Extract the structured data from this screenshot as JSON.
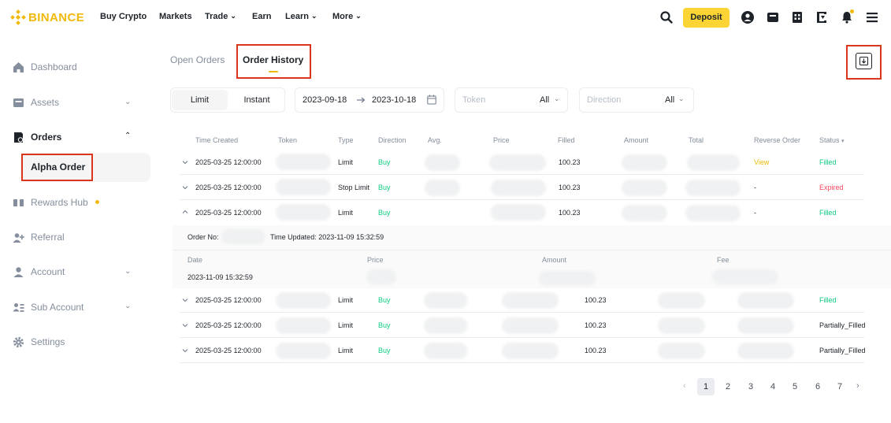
{
  "header": {
    "brand": "BINANCE",
    "nav": [
      {
        "label": "Buy Crypto",
        "has_dropdown": false
      },
      {
        "label": "Markets",
        "has_dropdown": false
      },
      {
        "label": "Trade",
        "has_dropdown": true
      },
      {
        "label": "Earn",
        "has_dropdown": false
      },
      {
        "label": "Learn",
        "has_dropdown": true
      },
      {
        "label": "More",
        "has_dropdown": true
      }
    ],
    "deposit_label": "Deposit",
    "icons": [
      "search-icon",
      "user-icon",
      "wallet-icon",
      "orders-icon",
      "download-app-icon",
      "bell-icon",
      "menu-icon"
    ],
    "accent": "#fcd535"
  },
  "sidebar": {
    "items": [
      {
        "label": "Dashboard",
        "icon": "home-icon"
      },
      {
        "label": "Assets",
        "icon": "wallet-icon",
        "expandable": true
      },
      {
        "label": "Orders",
        "icon": "orders-icon",
        "expanded": true
      },
      {
        "label": "Rewards Hub",
        "icon": "rewards-icon",
        "badge_dot": true
      },
      {
        "label": "Referral",
        "icon": "referral-icon"
      },
      {
        "label": "Account",
        "icon": "account-icon",
        "expandable": true
      },
      {
        "label": "Sub Account",
        "icon": "sub-account-icon",
        "expandable": true
      },
      {
        "label": "Settings",
        "icon": "settings-icon"
      }
    ],
    "sub_item": "Alpha Order"
  },
  "tabs": {
    "open_orders": "Open Orders",
    "order_history": "Order History"
  },
  "filters": {
    "segment": {
      "limit": "Limit",
      "instant": "Instant",
      "selected": "Limit"
    },
    "date_from": "2023-09-18",
    "date_to": "2023-10-18",
    "token": {
      "placeholder": "Token",
      "value": "All"
    },
    "direction": {
      "placeholder": "Direction",
      "value": "All"
    }
  },
  "table": {
    "columns": {
      "time_created": "Time Created",
      "token": "Token",
      "type": "Type",
      "direction": "Direction",
      "avg": "Avg.",
      "price": "Price",
      "filled": "Filled",
      "amount": "Amount",
      "total": "Total",
      "reverse_order": "Reverse Order",
      "status": "Status"
    },
    "rows": [
      {
        "time": "2025-03-25 12:00:00",
        "type": "Limit",
        "direction": "Buy",
        "filled": "100.23",
        "reverse": "View",
        "status": "Filled"
      },
      {
        "time": "2025-03-25 12:00:00",
        "type": "Stop Limit",
        "direction": "Buy",
        "filled": "100.23",
        "reverse": "-",
        "status": "Expired"
      },
      {
        "time": "2025-03-25 12:00:00",
        "type": "Limit",
        "direction": "Buy",
        "filled": "100.23",
        "reverse": "-",
        "status": "Filled"
      },
      {
        "time": "2025-03-25 12:00:00",
        "type": "Limit",
        "direction": "Buy",
        "filled": "100.23",
        "status": "Filled"
      },
      {
        "time": "2025-03-25 12:00:00",
        "type": "Limit",
        "direction": "Buy",
        "filled": "100.23",
        "status": "Partially_Filled"
      },
      {
        "time": "2025-03-25 12:00:00",
        "type": "Limit",
        "direction": "Buy",
        "filled": "100.23",
        "status": "Partially_Filled"
      }
    ],
    "detail": {
      "order_no_label": "Order No:",
      "time_updated": "Time Updated: 2023-11-09 15:32:59",
      "columns": {
        "date": "Date",
        "price": "Price",
        "amount": "Amount",
        "fee": "Fee"
      },
      "date_value": "2023-11-09 15:32:59"
    }
  },
  "pagination": {
    "pages": [
      "1",
      "2",
      "3",
      "4",
      "5",
      "6",
      "7"
    ],
    "current": "1"
  }
}
